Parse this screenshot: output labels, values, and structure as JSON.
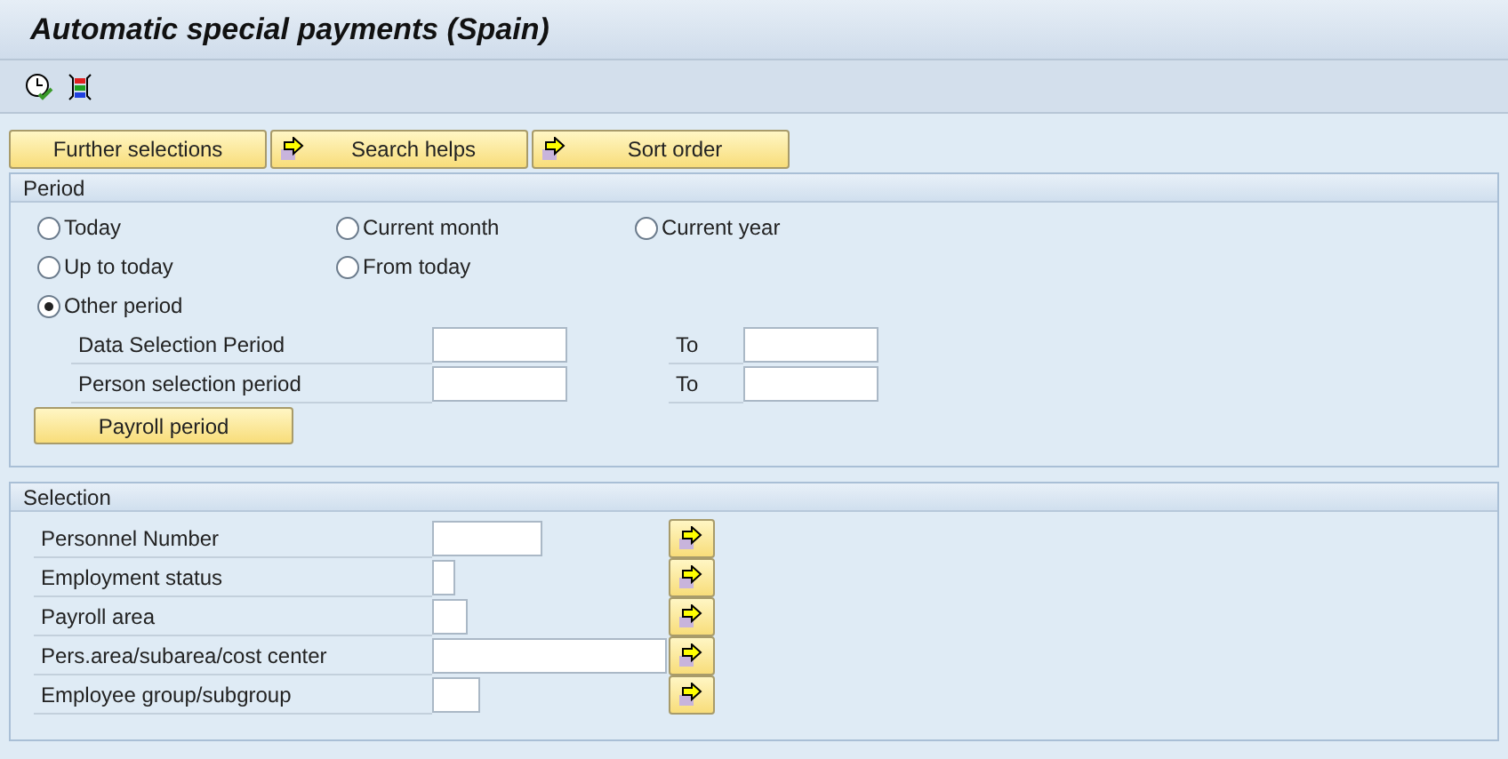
{
  "window": {
    "title": "Automatic special payments (Spain)"
  },
  "top_buttons": [
    {
      "label": "Further selections",
      "arrow": false
    },
    {
      "label": "Search helps",
      "arrow": true
    },
    {
      "label": "Sort order",
      "arrow": true
    }
  ],
  "period": {
    "title": "Period",
    "radios": [
      {
        "label": "Today",
        "selected": false
      },
      {
        "label": "Current month",
        "selected": false
      },
      {
        "label": "Current year",
        "selected": false
      },
      {
        "label": "Up to today",
        "selected": false
      },
      {
        "label": "From today",
        "selected": false
      },
      {
        "label": "Other period",
        "selected": true
      }
    ],
    "ranges": [
      {
        "label": "Data Selection Period",
        "to": "To"
      },
      {
        "label": "Person selection period",
        "to": "To"
      }
    ],
    "button": "Payroll period"
  },
  "selection": {
    "title": "Selection",
    "fields": [
      {
        "label": "Personnel Number"
      },
      {
        "label": "Employment status"
      },
      {
        "label": "Payroll area"
      },
      {
        "label": "Pers.area/subarea/cost center"
      },
      {
        "label": "Employee group/subgroup"
      }
    ]
  }
}
